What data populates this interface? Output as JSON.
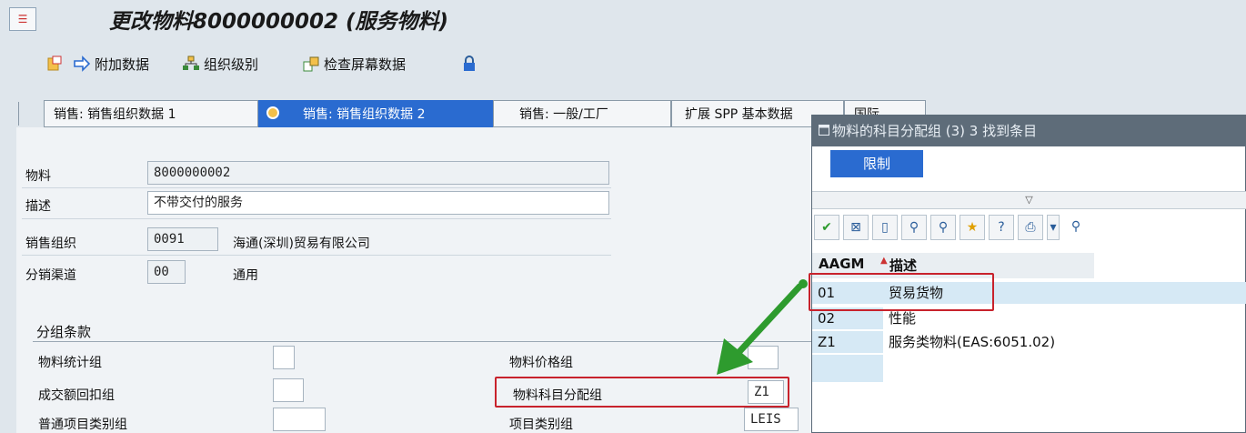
{
  "window": {
    "title": "更改物料8000000002 (服务物料)",
    "title_icon": "sap-menu-icon"
  },
  "toolbar": {
    "items": [
      {
        "label": "",
        "icon": "other-view-icon"
      },
      {
        "label": "附加数据",
        "icon": "arrow-right-icon"
      },
      {
        "label": "组织级别",
        "icon": "org-levels-icon"
      },
      {
        "label": "检查屏幕数据",
        "icon": "check-screen-icon"
      },
      {
        "label": "",
        "icon": "lock-icon"
      }
    ]
  },
  "tabs": [
    {
      "label": "销售: 销售组织数据 1",
      "active": false
    },
    {
      "label": "销售: 销售组织数据 2",
      "active": true
    },
    {
      "label": "销售: 一般/工厂",
      "active": false
    },
    {
      "label": "扩展 SPP 基本数据",
      "active": false
    },
    {
      "label": "国际",
      "active": false
    }
  ],
  "header_fields": {
    "material": {
      "label": "物料",
      "value": "8000000002"
    },
    "description": {
      "label": "描述",
      "value": "不带交付的服务"
    },
    "sales_org": {
      "label": "销售组织",
      "value": "0091",
      "text": "海通(深圳)贸易有限公司"
    },
    "dist_channel": {
      "label": "分销渠道",
      "value": "00",
      "text": "通用"
    }
  },
  "grouping": {
    "section_title": "分组条款",
    "left": [
      {
        "label": "物料统计组",
        "value": ""
      },
      {
        "label": "成交额回扣组",
        "value": ""
      },
      {
        "label": "普通项目类别组",
        "value": ""
      }
    ],
    "right": [
      {
        "label": "物料价格组",
        "value": ""
      },
      {
        "label": "物料科目分配组",
        "value": "Z1"
      },
      {
        "label": "项目类别组",
        "value": "LEIS"
      }
    ]
  },
  "popup": {
    "title": "物料的科目分配组 (3)   3 找到条目",
    "restrict_tab": "限制",
    "columns": [
      "AAGM",
      "描述"
    ],
    "rows": [
      {
        "code": "01",
        "desc": "贸易货物"
      },
      {
        "code": "02",
        "desc": "性能"
      },
      {
        "code": "Z1",
        "desc": "服务类物料(EAS:6051.02)"
      }
    ],
    "toolbar_icons": [
      "check-icon",
      "cancel-icon",
      "new-icon",
      "find-icon",
      "find-next-icon",
      "favorite-add-icon",
      "help-icon",
      "print-icon",
      "dropdown-icon",
      "settings-icon"
    ]
  },
  "colors": {
    "accent": "#2a6bd0",
    "highlight_box": "#c8222c",
    "arrow": "#2e9b2e"
  }
}
